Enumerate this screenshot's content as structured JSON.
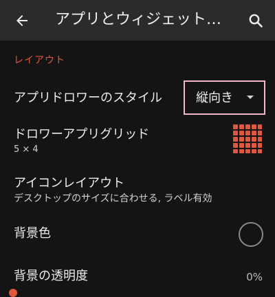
{
  "toolbar": {
    "title": "アプリとウィジェット…",
    "back_icon": "arrow-back-icon",
    "search_icon": "search-icon"
  },
  "section": {
    "header": "レイアウト"
  },
  "settings": {
    "drawer_style": {
      "label": "アプリドロワーのスタイル",
      "value": "縦向き",
      "arrow_icon": "dropdown-arrow-icon"
    },
    "drawer_grid": {
      "label": "ドロワーアプリグリッド",
      "summary": "5 × 4",
      "icon": "grid-icon"
    },
    "icon_layout": {
      "label": "アイコンレイアウト",
      "summary": "デスクトップのサイズに合わせる, ラベル有効"
    },
    "background_color": {
      "label": "背景色",
      "swatch_color": "#141414"
    },
    "background_transparency": {
      "label": "背景の透明度",
      "value": "0%"
    }
  },
  "colors": {
    "accent": "#e0593e",
    "toolbar_bg": "#2b2b2b",
    "page_bg": "#141414",
    "highlight_border": "#f4b6c8"
  }
}
